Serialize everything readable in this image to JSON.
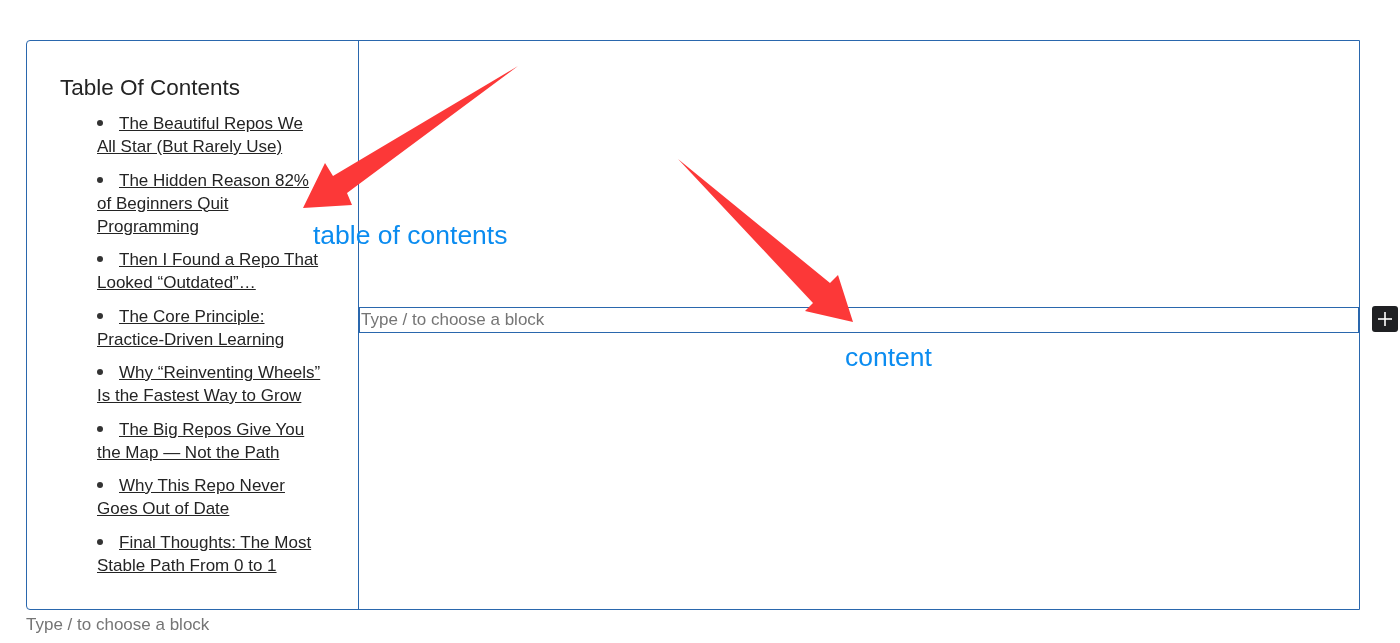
{
  "toc": {
    "title": "Table Of Contents",
    "items": [
      {
        "label": "The Beautiful Repos We All Star (But Rarely Use)"
      },
      {
        "label": "The Hidden Reason 82% of Beginners Quit Programming"
      },
      {
        "label": "Then I Found a Repo That Looked “Outdated”…"
      },
      {
        "label": "The Core Principle: Practice-Driven Learning"
      },
      {
        "label": "Why “Reinventing Wheels” Is the Fastest Way to Grow"
      },
      {
        "label": "The Big Repos Give You the Map — Not the Path"
      },
      {
        "label": "Why This Repo Never Goes Out of Date"
      },
      {
        "label": "Final Thoughts: The Most Stable Path From 0 to 1"
      }
    ]
  },
  "content_block": {
    "placeholder": "Type / to choose a block"
  },
  "trailing_block": {
    "placeholder": "Type / to choose a block"
  },
  "annotations": [
    {
      "label": "table of contents"
    },
    {
      "label": "content"
    }
  ]
}
